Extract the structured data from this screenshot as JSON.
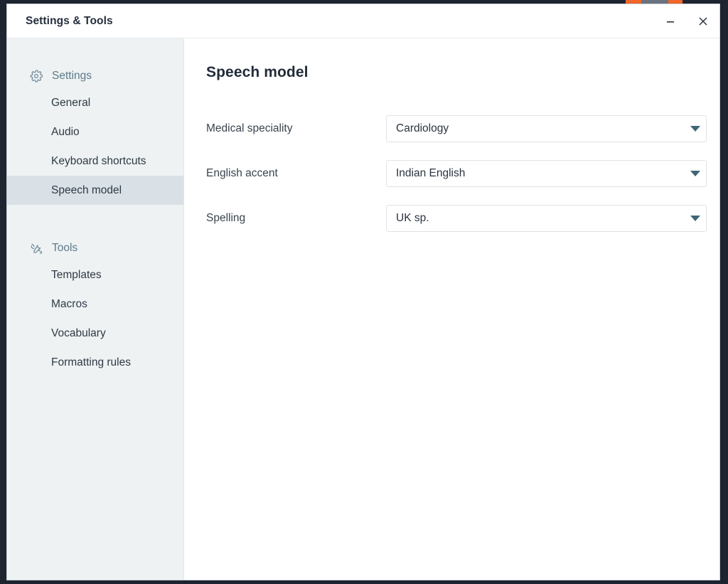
{
  "window": {
    "title": "Settings & Tools",
    "controls": {
      "minimize_label": "Minimize",
      "minimize_icon": "minimize-icon",
      "close_label": "Close",
      "close_icon": "close-icon"
    }
  },
  "sidebar": {
    "groups": [
      {
        "header": "Settings",
        "icon": "gear-icon",
        "items": [
          {
            "label": "General",
            "selected": false
          },
          {
            "label": "Audio",
            "selected": false
          },
          {
            "label": "Keyboard shortcuts",
            "selected": false
          },
          {
            "label": "Speech model",
            "selected": true
          }
        ]
      },
      {
        "header": "Tools",
        "icon": "tools-icon",
        "items": [
          {
            "label": "Templates",
            "selected": false
          },
          {
            "label": "Macros",
            "selected": false
          },
          {
            "label": "Vocabulary",
            "selected": false
          },
          {
            "label": "Formatting rules",
            "selected": false
          }
        ]
      }
    ]
  },
  "main": {
    "title": "Speech model",
    "fields": [
      {
        "label": "Medical speciality",
        "value": "Cardiology",
        "caret_icon": "chevron-down-icon"
      },
      {
        "label": "English accent",
        "value": "Indian English",
        "caret_icon": "chevron-down-icon"
      },
      {
        "label": "Spelling",
        "value": "UK sp.",
        "caret_icon": "chevron-down-icon"
      }
    ]
  },
  "colors": {
    "sidebar_bg": "#eef2f3",
    "sidebar_selected": "#d9e0e6",
    "header_text": "#5e7a89",
    "caret": "#3f6576",
    "desktop_bg": "#1e2430",
    "desktop_accent": "#f2662a"
  }
}
